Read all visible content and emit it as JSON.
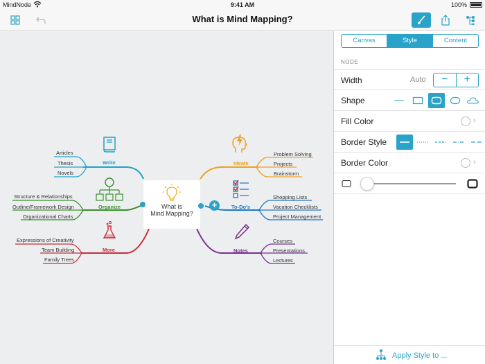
{
  "status": {
    "carrier": "MindNode",
    "time": "9:41 AM",
    "battery": "100%"
  },
  "toolbar": {
    "title": "What is Mind Mapping?"
  },
  "center": {
    "line1": "What is",
    "line2": "Mind Mapping?"
  },
  "branches": {
    "write": {
      "title": "Write",
      "color": "#1fa3c9",
      "items": [
        "Articles",
        "Thesis",
        "Novels"
      ]
    },
    "organize": {
      "title": "Organize",
      "color": "#3b8f2c",
      "items": [
        "Structure & Relationships",
        "Outline/Framework Design",
        "Organizational Charts"
      ]
    },
    "more": {
      "title": "More",
      "color": "#c62f3a",
      "items": [
        "Expressions of Creativity",
        "Team Building",
        "Family Trees"
      ]
    },
    "ideate": {
      "title": "Ideate",
      "color": "#f0a01f",
      "items": [
        "Problem Solving",
        "Projects",
        "Brainstorm"
      ]
    },
    "todos": {
      "title": "To-Do's",
      "color": "#1f79c2",
      "items": [
        "Shopping Lists",
        "Vacation Checklists",
        "Project Management"
      ]
    },
    "notes": {
      "title": "Notes",
      "color": "#7a2f92",
      "items": [
        "Courses",
        "Presentations",
        "Lectures"
      ]
    }
  },
  "inspector": {
    "tabs": [
      "Canvas",
      "Style",
      "Content"
    ],
    "section": "NODE",
    "width_label": "Width",
    "width_value": "Auto",
    "minus": "−",
    "plus": "+",
    "shape_label": "Shape",
    "fill_label": "Fill Color",
    "border_style_label": "Border Style",
    "border_color_label": "Border Color",
    "apply_label": "Apply Style to ..."
  },
  "colors": {
    "accent": "#2aa3c8"
  }
}
